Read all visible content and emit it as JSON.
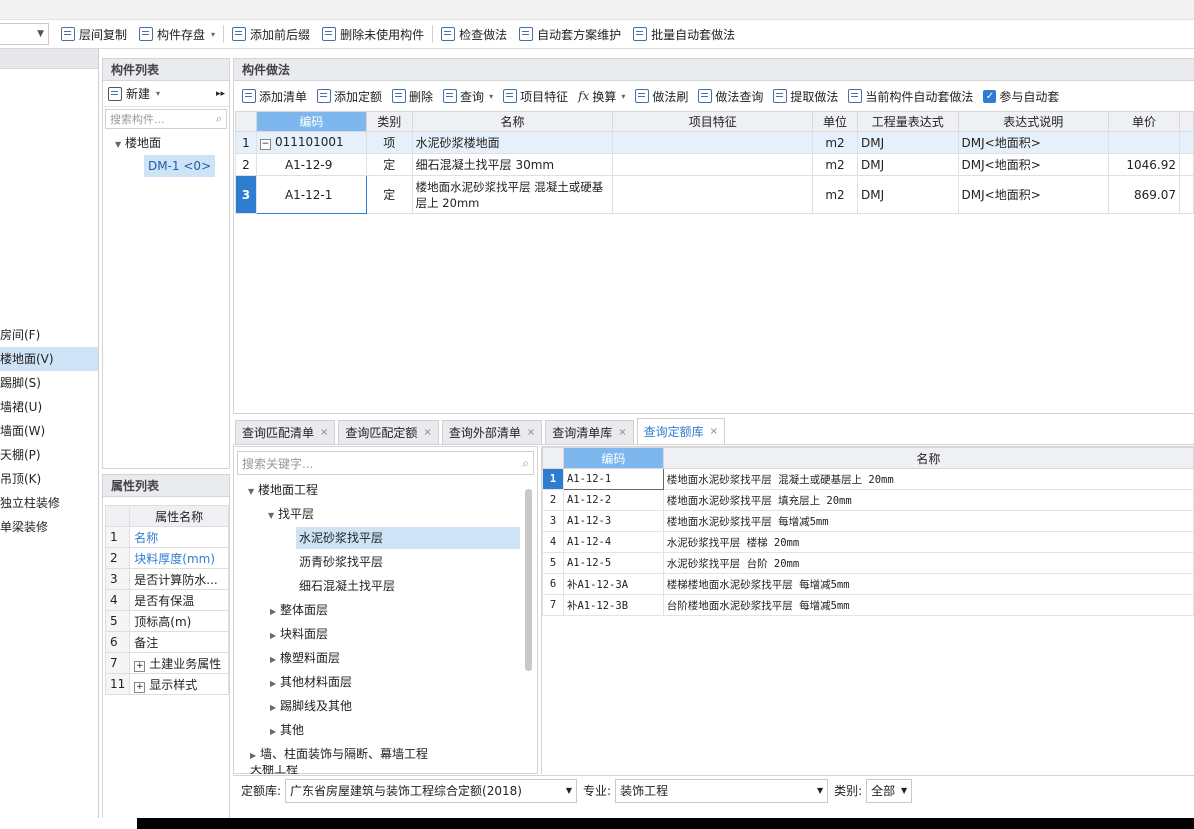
{
  "toolbar": {
    "items": [
      "层间复制",
      "构件存盘",
      "添加前后缀",
      "删除未使用构件",
      "检查做法",
      "自动套方案维护",
      "批量自动套做法"
    ]
  },
  "left_nav": {
    "items": [
      "房间(F)",
      "楼地面(V)",
      "踢脚(S)",
      "墙裙(U)",
      "墙面(W)",
      "天棚(P)",
      "吊顶(K)",
      "独立柱装修",
      "单梁装修"
    ],
    "selected_index": 1
  },
  "component_list": {
    "title": "构件列表",
    "new_label": "新建",
    "search_placeholder": "搜索构件...",
    "tree_root": "楼地面",
    "tree_child": "DM-1 <0>"
  },
  "property_list": {
    "title": "属性列表",
    "header": "属性名称",
    "rows": [
      {
        "num": "1",
        "name": "名称"
      },
      {
        "num": "2",
        "name": "块料厚度(mm)"
      },
      {
        "num": "3",
        "name": "是否计算防水..."
      },
      {
        "num": "4",
        "name": "是否有保温"
      },
      {
        "num": "5",
        "name": "顶标高(m)"
      },
      {
        "num": "6",
        "name": "备注"
      },
      {
        "num": "7",
        "name": "土建业务属性"
      },
      {
        "num": "11",
        "name": "显示样式"
      }
    ]
  },
  "method_panel": {
    "title": "构件做法",
    "toolbar": [
      "添加清单",
      "添加定额",
      "删除",
      "查询",
      "项目特征",
      "换算",
      "做法刷",
      "做法查询",
      "提取做法",
      "当前构件自动套做法",
      "参与自动套"
    ],
    "columns": [
      "编码",
      "类别",
      "名称",
      "项目特征",
      "单位",
      "工程量表达式",
      "表达式说明",
      "单价"
    ],
    "rows": [
      {
        "num": "1",
        "code": "011101001",
        "type": "项",
        "name": "水泥砂浆楼地面",
        "feature": "",
        "unit": "m2",
        "expr": "DMJ",
        "desc": "DMJ<地面积>",
        "price": ""
      },
      {
        "num": "2",
        "code": "A1-12-9",
        "type": "定",
        "name": "细石混凝土找平层 30mm",
        "feature": "",
        "unit": "m2",
        "expr": "DMJ",
        "desc": "DMJ<地面积>",
        "price": "1046.92"
      },
      {
        "num": "3",
        "code": "A1-12-1",
        "type": "定",
        "name": "楼地面水泥砂浆找平层 混凝土或硬基层上 20mm",
        "feature": "",
        "unit": "m2",
        "expr": "DMJ",
        "desc": "DMJ<地面积>",
        "price": "869.07"
      }
    ]
  },
  "tabs": [
    {
      "label": "查询匹配清单",
      "active": false
    },
    {
      "label": "查询匹配定额",
      "active": false
    },
    {
      "label": "查询外部清单",
      "active": false
    },
    {
      "label": "查询清单库",
      "active": false
    },
    {
      "label": "查询定额库",
      "active": true
    }
  ],
  "quota_tree": {
    "search_placeholder": "搜索关键字...",
    "nodes": [
      "楼地面工程",
      "找平层",
      "水泥砂浆找平层",
      "沥青砂浆找平层",
      "细石混凝土找平层",
      "整体面层",
      "块料面层",
      "橡塑料面层",
      "其他材料面层",
      "踢脚线及其他",
      "其他",
      "墙、柱面装饰与隔断、幕墙工程",
      "天棚工程"
    ],
    "selected": "水泥砂浆找平层"
  },
  "quota_table": {
    "columns": [
      "编码",
      "名称"
    ],
    "rows": [
      {
        "num": "1",
        "code": "A1-12-1",
        "name": "楼地面水泥砂浆找平层 混凝土或硬基层上 20mm"
      },
      {
        "num": "2",
        "code": "A1-12-2",
        "name": "楼地面水泥砂浆找平层 填充层上 20mm"
      },
      {
        "num": "3",
        "code": "A1-12-3",
        "name": "楼地面水泥砂浆找平层 每增减5mm"
      },
      {
        "num": "4",
        "code": "A1-12-4",
        "name": "水泥砂浆找平层 楼梯 20mm"
      },
      {
        "num": "5",
        "code": "A1-12-5",
        "name": "水泥砂浆找平层 台阶 20mm"
      },
      {
        "num": "6",
        "code": "补A1-12-3A",
        "name": "楼梯楼地面水泥砂浆找平层 每增减5mm"
      },
      {
        "num": "7",
        "code": "补A1-12-3B",
        "name": "台阶楼地面水泥砂浆找平层 每增减5mm"
      }
    ]
  },
  "bottom_bar": {
    "quota_lib_label": "定额库:",
    "quota_lib_value": "广东省房屋建筑与装饰工程综合定额(2018)",
    "major_label": "专业:",
    "major_value": "装饰工程",
    "category_label": "类别:",
    "category_value": "全部"
  },
  "colors": {
    "accent": "#2f7dd1",
    "selected_bg": "#cfe3f7",
    "header_bg": "#eef0f3"
  }
}
